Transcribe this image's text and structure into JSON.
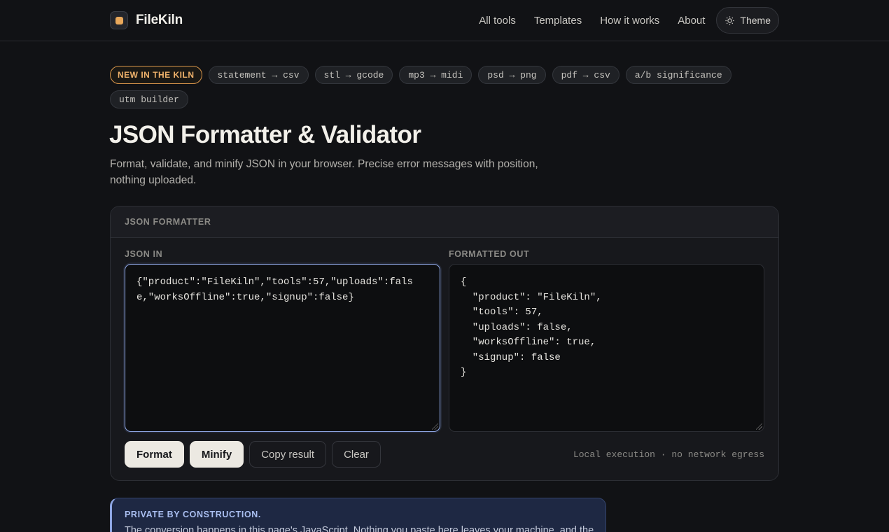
{
  "brand": {
    "name": "FileKiln"
  },
  "nav": {
    "items": [
      "All tools",
      "Templates",
      "How it works",
      "About"
    ],
    "theme_label": "Theme"
  },
  "chips": {
    "new_label": "NEW IN THE KILN",
    "items": [
      "statement → csv",
      "stl → gcode",
      "mp3 → midi",
      "psd → png",
      "pdf → csv",
      "a/b significance",
      "utm builder"
    ]
  },
  "page": {
    "title": "JSON Formatter & Validator",
    "subtitle": "Format, validate, and minify JSON in your browser. Precise error messages with position, nothing uploaded."
  },
  "formatter": {
    "header": "JSON FORMATTER",
    "input_label": "JSON IN",
    "output_label": "FORMATTED OUT",
    "input_value": "{\"product\":\"FileKiln\",\"tools\":57,\"uploads\":false,\"worksOffline\":true,\"signup\":false}",
    "output_value": "{\n  \"product\": \"FileKiln\",\n  \"tools\": 57,\n  \"uploads\": false,\n  \"worksOffline\": true,\n  \"signup\": false\n}",
    "buttons": {
      "format": "Format",
      "minify": "Minify",
      "copy": "Copy result",
      "clear": "Clear"
    },
    "local_note": "Local execution · no network egress"
  },
  "notice": {
    "title": "PRIVATE BY CONSTRUCTION.",
    "body": "The conversion happens in this page's JavaScript. Nothing you paste here leaves your machine, and the"
  },
  "colors": {
    "accent": "#e9a85b",
    "focus": "#8ea6e3",
    "background": "#111215"
  }
}
